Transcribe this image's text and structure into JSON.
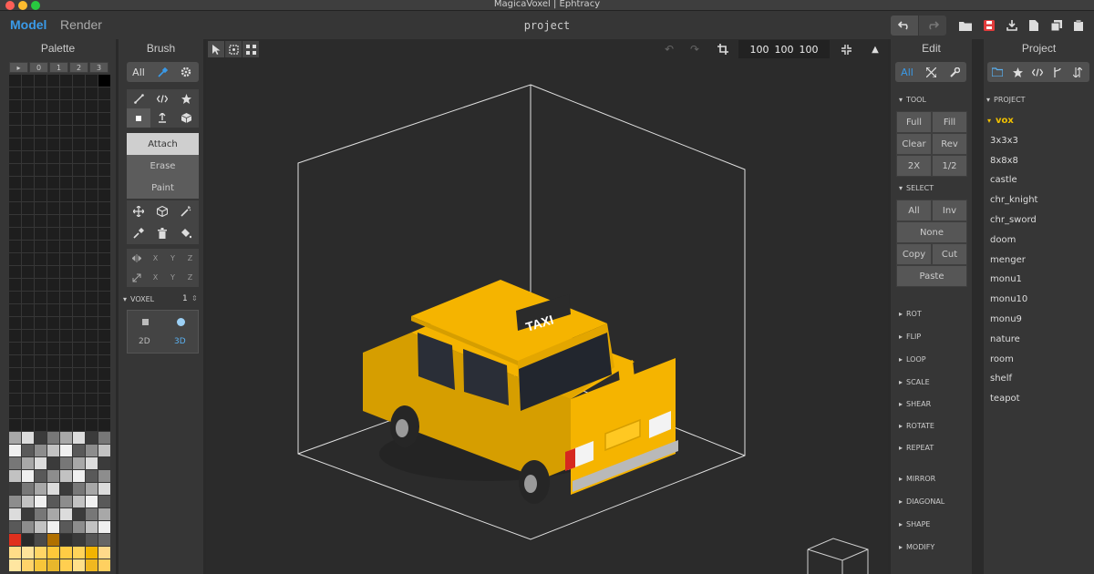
{
  "window": {
    "title": "MagicaVoxel | Ephtracy"
  },
  "topbar": {
    "mode_model": "Model",
    "mode_render": "Render",
    "project_name": "project"
  },
  "palette": {
    "title": "Palette",
    "tabs": [
      "▸",
      "0",
      "1",
      "2",
      "3"
    ]
  },
  "brush": {
    "title": "Brush",
    "all_label": "All",
    "modes": [
      "Attach",
      "Erase",
      "Paint"
    ],
    "axes": [
      "X",
      "Y",
      "Z"
    ],
    "voxel_label": "VOXEL",
    "voxel_value": "1",
    "dim_2d": "2D",
    "dim_3d": "3D"
  },
  "viewport": {
    "dims": [
      "100",
      "100",
      "100"
    ],
    "taxi_sign": "TAXI"
  },
  "edit": {
    "title": "Edit",
    "all_label": "All",
    "tool_header": "TOOL",
    "tool_buttons": [
      "Full",
      "Fill",
      "Clear",
      "Rev",
      "2X",
      "1/2"
    ],
    "select_header": "SELECT",
    "select_all": "All",
    "select_inv": "Inv",
    "select_none": "None",
    "select_copy": "Copy",
    "select_cut": "Cut",
    "select_paste": "Paste",
    "sections": [
      "ROT",
      "FLIP",
      "LOOP",
      "SCALE",
      "SHEAR",
      "ROTATE",
      "REPEAT",
      "MIRROR",
      "DIAGONAL",
      "SHAPE",
      "MODIFY"
    ]
  },
  "project": {
    "title": "Project",
    "header": "PROJECT",
    "items": [
      "vox",
      "3x3x3",
      "8x8x8",
      "castle",
      "chr_knight",
      "chr_sword",
      "doom",
      "menger",
      "monu1",
      "monu10",
      "monu9",
      "nature",
      "room",
      "shelf",
      "teapot"
    ],
    "selected": "vox"
  },
  "colors": {
    "accent": "#2e8ad8",
    "selected_item": "#f0c000",
    "taxi_yellow": "#f5b400"
  },
  "icons": {
    "undo": "undo-icon",
    "redo": "redo-icon",
    "open": "folder-icon",
    "save": "save-icon",
    "export": "export-icon",
    "new": "new-file-icon",
    "copy": "copy-icon"
  }
}
